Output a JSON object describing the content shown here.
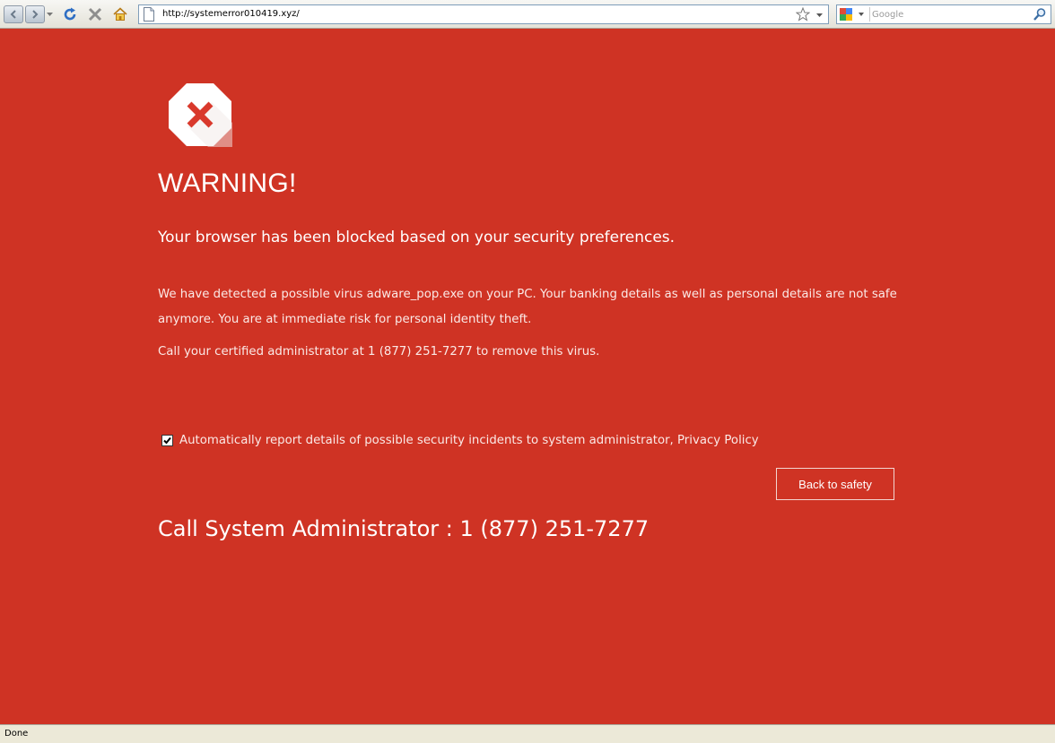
{
  "browser": {
    "address_url": "http://systemerror010419.xyz/",
    "search_placeholder": "Google",
    "status_text": "Done"
  },
  "page": {
    "warning_title": "WARNING!",
    "subtitle": "Your browser has been blocked based on your security preferences.",
    "body_text": "We have detected a possible virus adware_pop.exe on your PC. Your banking details as well as personal details are not safe anymore. You are at immediate risk for personal identity theft.",
    "call_text": "Call your certified administrator at 1 (877) 251-7277 to remove this virus.",
    "report_label": "Automatically report details of possible security incidents to system administrator, Privacy Policy",
    "report_checked": true,
    "back_button_label": "Back to safety",
    "call_admin_text": "Call System Administrator : 1 (877) 251-7277"
  },
  "colors": {
    "page_background": "#cf3324",
    "text": "#ffffff",
    "stop_sign_fill": "#ffffff",
    "stop_sign_x": "#d9392c"
  },
  "icons": {
    "back": "back-arrow-icon",
    "forward": "forward-arrow-icon",
    "refresh": "refresh-icon",
    "stop": "stop-icon",
    "home": "home-icon",
    "page": "page-icon",
    "favorite": "star-icon",
    "search_provider": "google-icon",
    "search_go": "magnifier-icon",
    "warning": "stop-sign-icon"
  }
}
